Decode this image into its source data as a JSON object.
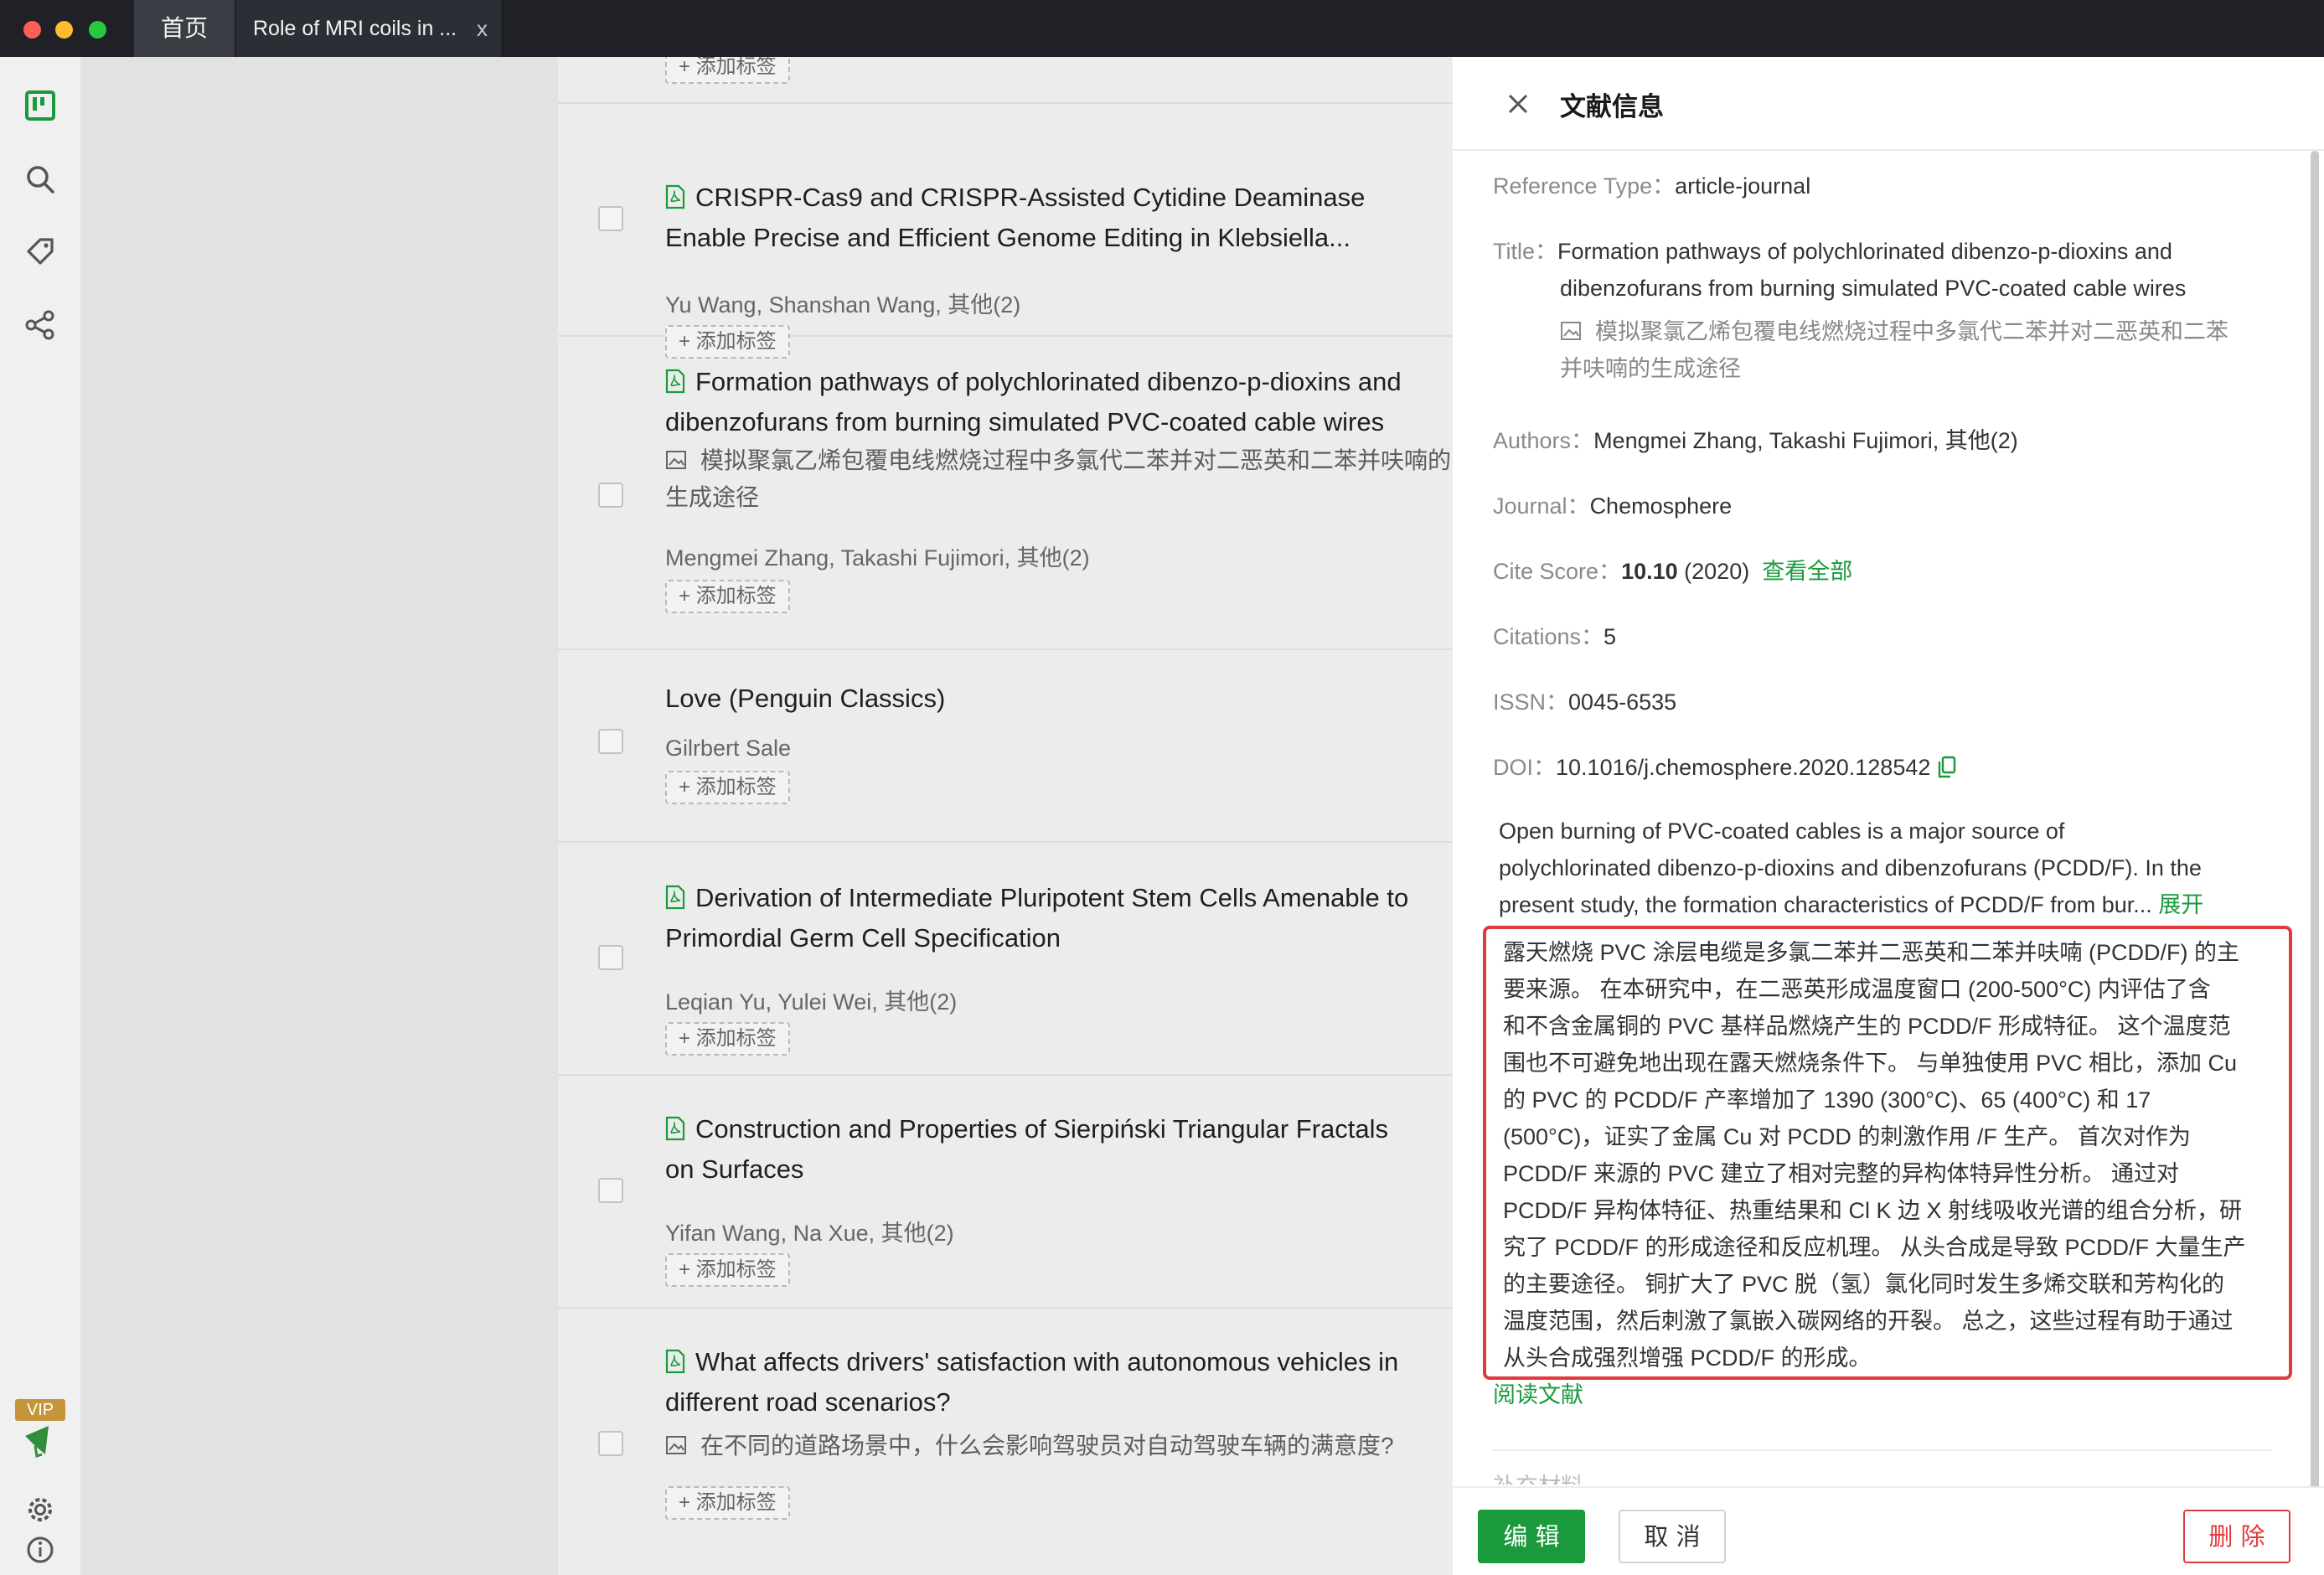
{
  "window": {
    "tabs": [
      {
        "label": "首页"
      },
      {
        "label": "Role of MRI coils in ...",
        "close": "x"
      }
    ]
  },
  "list": {
    "add_tag_label": "+ 添加标签",
    "items": [
      {
        "title_lines": [
          "CRISPR-Cas9 and CRISPR-Assisted Cytidine Deaminase",
          "Enable Precise and Efficient Genome Editing in Klebsiella..."
        ],
        "authors": "Yu Wang, Shanshan Wang, 其他(2)",
        "has_pdf": true
      },
      {
        "title_lines": [
          "Formation pathways of polychlorinated dibenzo-p-dioxins and",
          "dibenzofurans from burning simulated PVC-coated cable wires"
        ],
        "translation_lines": [
          "模拟聚氯乙烯包覆电线燃烧过程中多氯代二苯并对二恶英和二苯并呋喃的",
          "生成途径"
        ],
        "authors": "Mengmei Zhang, Takashi Fujimori, 其他(2)",
        "has_pdf": true
      },
      {
        "title_lines": [
          "Love (Penguin Classics)"
        ],
        "authors": "Gilrbert Sale",
        "has_pdf": false
      },
      {
        "title_lines": [
          "Derivation of Intermediate Pluripotent Stem Cells Amenable to",
          "Primordial Germ Cell Specification"
        ],
        "authors": "Leqian Yu, Yulei Wei, 其他(2)",
        "has_pdf": true
      },
      {
        "title_lines": [
          "Construction and Properties of Sierpiński Triangular Fractals",
          "on Surfaces"
        ],
        "authors": "Yifan Wang, Na Xue, 其他(2)",
        "has_pdf": true
      },
      {
        "title_lines": [
          "What affects drivers' satisfaction with autonomous vehicles in",
          "different road scenarios?"
        ],
        "translation_lines": [
          "在不同的道路场景中，什么会影响驾驶员对自动驾驶车辆的满意度?"
        ],
        "has_pdf": true
      }
    ]
  },
  "panel": {
    "title": "文献信息",
    "reference_type": {
      "label": "Reference Type：",
      "value": "article-journal"
    },
    "title_field": {
      "label": "Title：",
      "value_lines": [
        "Formation pathways of polychlorinated dibenzo-p-dioxins and",
        "dibenzofurans from burning simulated PVC-coated cable wires"
      ],
      "translation_lines": [
        "模拟聚氯乙烯包覆电线燃烧过程中多氯代二苯并对二恶英和二苯",
        "并呋喃的生成途径"
      ]
    },
    "authors": {
      "label": "Authors：",
      "value": "Mengmei Zhang, Takashi Fujimori, 其他(2)"
    },
    "journal": {
      "label": "Journal：",
      "value": "Chemosphere"
    },
    "cite_score": {
      "label": "Cite Score：",
      "score": "10.10",
      "year": "(2020)",
      "link": "查看全部"
    },
    "citations": {
      "label": "Citations：",
      "value": "5"
    },
    "issn": {
      "label": "ISSN：",
      "value": "0045-6535"
    },
    "doi": {
      "label": "DOI：",
      "value": "10.1016/j.chemosphere.2020.128542"
    },
    "abstract_en_lines": [
      "Open burning of PVC-coated cables is a major source of",
      "polychlorinated dibenzo-p-dioxins and dibenzofurans (PCDD/F). In the",
      "present study, the formation characteristics of PCDD/F from bur..."
    ],
    "expand_label": "展开",
    "abstract_zh_lines": [
      "露天燃烧 PVC 涂层电缆是多氯二苯并二恶英和二苯并呋喃 (PCDD/F) 的主",
      "要来源。 在本研究中，在二恶英形成温度窗口 (200-500°C) 内评估了含",
      "和不含金属铜的 PVC 基样品燃烧产生的 PCDD/F 形成特征。 这个温度范",
      "围也不可避免地出现在露天燃烧条件下。 与单独使用 PVC 相比，添加 Cu",
      "的 PVC 的 PCDD/F 产率增加了 1390 (300°C)、65 (400°C) 和 17",
      "(500°C)，证实了金属 Cu 对 PCDD 的刺激作用 /F 生产。 首次对作为",
      "PCDD/F 来源的 PVC 建立了相对完整的异构体特异性分析。 通过对",
      "PCDD/F 异构体特征、热重结果和 Cl K 边 X 射线吸收光谱的组合分析，研",
      "究了 PCDD/F 的形成途径和反应机理。 从头合成是导致 PCDD/F 大量生产",
      "的主要途径。 铜扩大了 PVC 脱（氢）氯化同时发生多烯交联和芳构化的",
      "温度范围，然后刺激了氯嵌入碳网络的开裂。 总之，这些过程有助于通过",
      "从头合成强烈增强 PCDD/F 的形成。"
    ],
    "read_link": "阅读文献",
    "supplement_label": "补充材料",
    "buttons": {
      "edit": "编 辑",
      "cancel": "取 消",
      "delete": "删 除"
    }
  },
  "sidebar": {
    "vip_label": "VIP"
  }
}
